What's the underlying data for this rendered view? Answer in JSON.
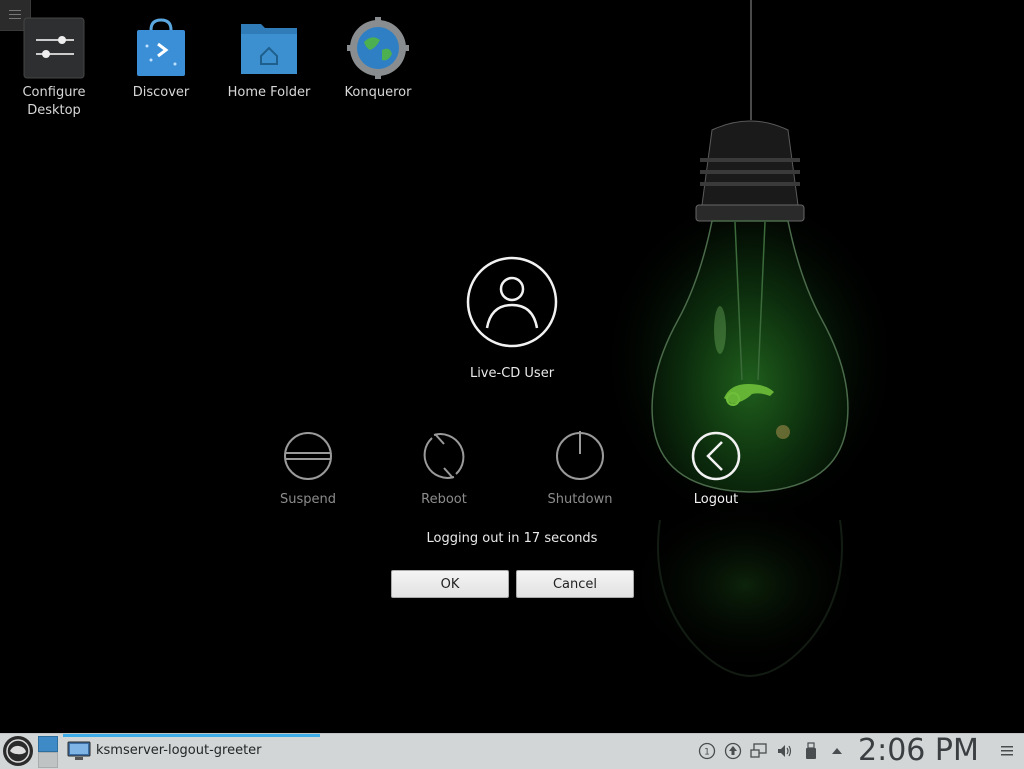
{
  "desktop": {
    "icons": [
      {
        "label": "Configure Desktop",
        "icon": "configure-desktop-icon"
      },
      {
        "label": "Discover",
        "icon": "discover-bag-icon"
      },
      {
        "label": "Home Folder",
        "icon": "home-folder-icon"
      },
      {
        "label": "Konqueror",
        "icon": "konqueror-globe-icon"
      }
    ]
  },
  "greeter": {
    "user_name": "Live-CD User",
    "actions": [
      {
        "label": "Suspend",
        "icon": "suspend-icon",
        "active": false
      },
      {
        "label": "Reboot",
        "icon": "reboot-icon",
        "active": false
      },
      {
        "label": "Shutdown",
        "icon": "shutdown-icon",
        "active": false
      },
      {
        "label": "Logout",
        "icon": "logout-icon",
        "active": true
      }
    ],
    "countdown": "Logging out in 17 seconds",
    "ok_label": "OK",
    "cancel_label": "Cancel"
  },
  "taskbar": {
    "task_title": "ksmserver-logout-greeter",
    "clock": "2:06 PM",
    "tray_icons": [
      "notifications-icon",
      "updates-icon",
      "network-icon",
      "volume-icon",
      "removable-device-icon",
      "expand-tray-icon"
    ]
  },
  "colors": {
    "accent": "#3daee9",
    "panel": "#d2d6d7",
    "bulb_glow": "#2fa52a"
  }
}
